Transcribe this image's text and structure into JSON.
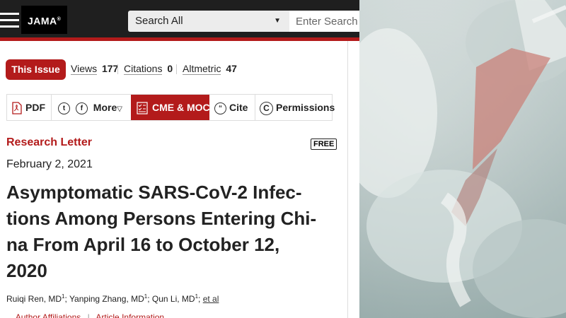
{
  "header": {
    "logo": "JAMA",
    "search_select": "Search All",
    "search_placeholder": "Enter Search Te"
  },
  "issue_button": "This Issue",
  "metrics": [
    {
      "label": "Views",
      "value": "177"
    },
    {
      "label": "Citations",
      "value": "0"
    },
    {
      "label": "Altmetric",
      "value": "47"
    }
  ],
  "toolbar": {
    "pdf": "PDF",
    "more": "More",
    "cme": "CME & MOC",
    "cite": "Cite",
    "permissions": "Permissions"
  },
  "article": {
    "type": "Research Letter",
    "free_badge": "FREE",
    "date": "February 2, 2021",
    "title_lines": [
      "Asymptomatic SARS-CoV-2 Infec-",
      "tions Among Persons Entering Chi-",
      "na From April 16 to October 12,",
      "2020"
    ],
    "authors": [
      {
        "name": "Ruiqi Ren, MD",
        "sup": "1"
      },
      {
        "name": "Yanping Zhang, MD",
        "sup": "1"
      },
      {
        "name": "Qun Li, MD",
        "sup": "1"
      }
    ],
    "et_al": "et al",
    "author_affiliations": "Author Affiliations",
    "article_information": "Article Information"
  },
  "colors": {
    "brand_red": "#b31b1b",
    "header_dark": "#1f1f1f"
  },
  "icons": [
    "menu-icon",
    "caret-down-icon",
    "pdf-icon",
    "twitter-icon",
    "facebook-icon",
    "checklist-icon",
    "quote-icon",
    "copyright-icon"
  ]
}
